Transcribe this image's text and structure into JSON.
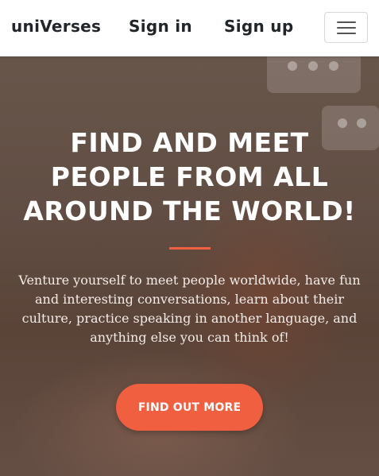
{
  "navbar": {
    "brand": "uniVerses",
    "signin_label": "Sign in",
    "signup_label": "Sign up",
    "menu_icon": "hamburger-menu-icon"
  },
  "hero": {
    "title": "FIND AND MEET PEOPLE FROM ALL AROUND THE WORLD!",
    "text": "Venture yourself to meet people worldwide, have fun and interesting conversations, learn about their culture, practice speaking in another language, and anything else you can think of!",
    "cta_label": "FIND OUT MORE",
    "background_icons": [
      "chat-bubble-icon",
      "chat-bubble-icon"
    ]
  },
  "colors": {
    "accent": "#f05f40",
    "nav_text": "#212529",
    "hero_text": "#ffffff"
  }
}
